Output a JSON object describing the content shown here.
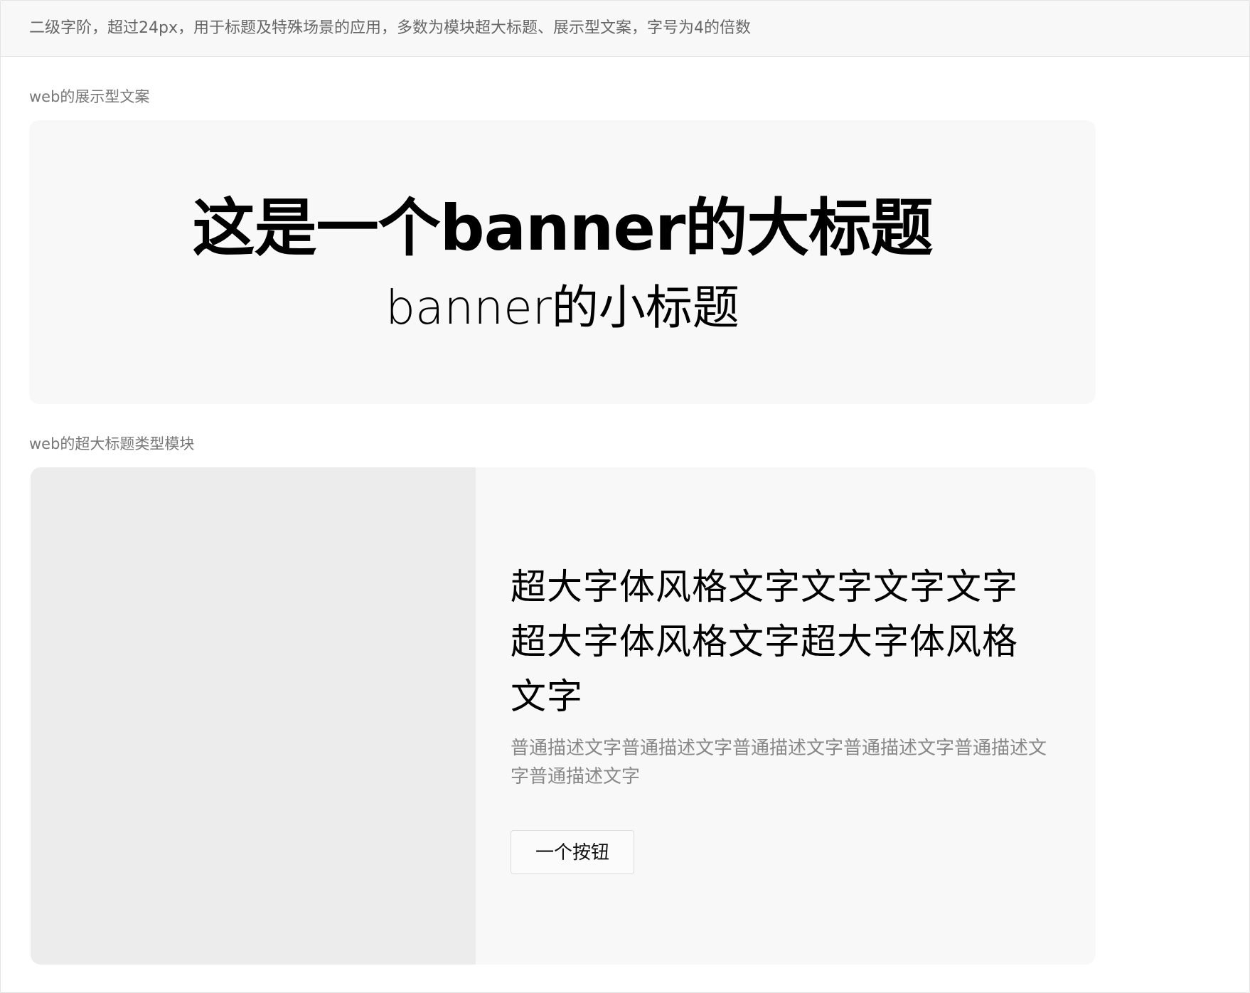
{
  "header": {
    "description": "二级字阶，超过24px，用于标题及特殊场景的应用，多数为模块超大标题、展示型文案，字号为4的倍数"
  },
  "sections": {
    "banner": {
      "label": "web的展示型文案",
      "title": "这是一个banner的大标题",
      "subtitle": "banner的小标题"
    },
    "module": {
      "label": "web的超大标题类型模块",
      "title": "超大字体风格文字文字文字文字超大字体风格文字超大字体风格文字",
      "description": "普通描述文字普通描述文字普通描述文字普通描述文字普通描述文字普通描述文字",
      "button_label": "一个按钮"
    }
  },
  "colors": {
    "page_background": "#ffffff",
    "header_background": "#f8f8f8",
    "card_background": "#f8f8f8",
    "image_placeholder": "#ececec",
    "muted_text": "#888888"
  }
}
